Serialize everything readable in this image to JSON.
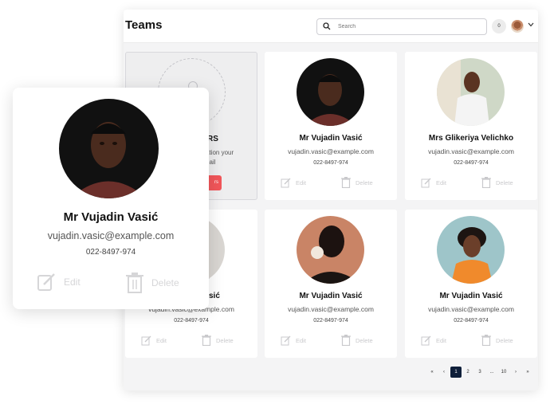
{
  "header": {
    "title": "Teams",
    "search_placeholder": "Search",
    "notification_count": "0"
  },
  "placeholder_card": {
    "heading_partial": "RS",
    "text_line1": "ation your",
    "text_line2": "nail",
    "button_partial": "rs"
  },
  "cards": [
    {
      "name": "Mr Vujadin Vasić",
      "email": "vujadin.vasic@example.com",
      "phone": "022-8497-974",
      "edit": "Edit",
      "delete": "Delete"
    },
    {
      "name": "Mrs Glikeriya Velichko",
      "email": "vujadin.vasic@example.com",
      "phone": "022-8497-974",
      "edit": "Edit",
      "delete": "Delete"
    },
    {
      "name": "sić",
      "email": "vujadin.vasic@example.com",
      "phone": "022-8497-974",
      "edit": "Edit",
      "delete": "Delete"
    },
    {
      "name": "Mr Vujadin Vasić",
      "email": "vujadin.vasic@example.com",
      "phone": "022-8497-974",
      "edit": "Edit",
      "delete": "Delete"
    },
    {
      "name": "Mr Vujadin Vasić",
      "email": "vujadin.vasic@example.com",
      "phone": "022-8497-974",
      "edit": "Edit",
      "delete": "Delete"
    }
  ],
  "featured_card": {
    "name": "Mr Vujadin Vasić",
    "email": "vujadin.vasic@example.com",
    "phone": "022-8497-974",
    "edit": "Edit",
    "delete": "Delete"
  },
  "pagination": {
    "first": "«",
    "prev": "‹",
    "pages": [
      "1",
      "2",
      "3",
      "...",
      "10"
    ],
    "active": "1",
    "next": "›",
    "last": "»"
  },
  "colors": {
    "accent": "#0f1f3a",
    "danger": "#f2565a",
    "background": "#f4f4f5"
  },
  "icons": {
    "search": "search-icon",
    "edit": "edit-icon",
    "delete": "trash-icon",
    "chevron": "chevron-down-icon"
  }
}
